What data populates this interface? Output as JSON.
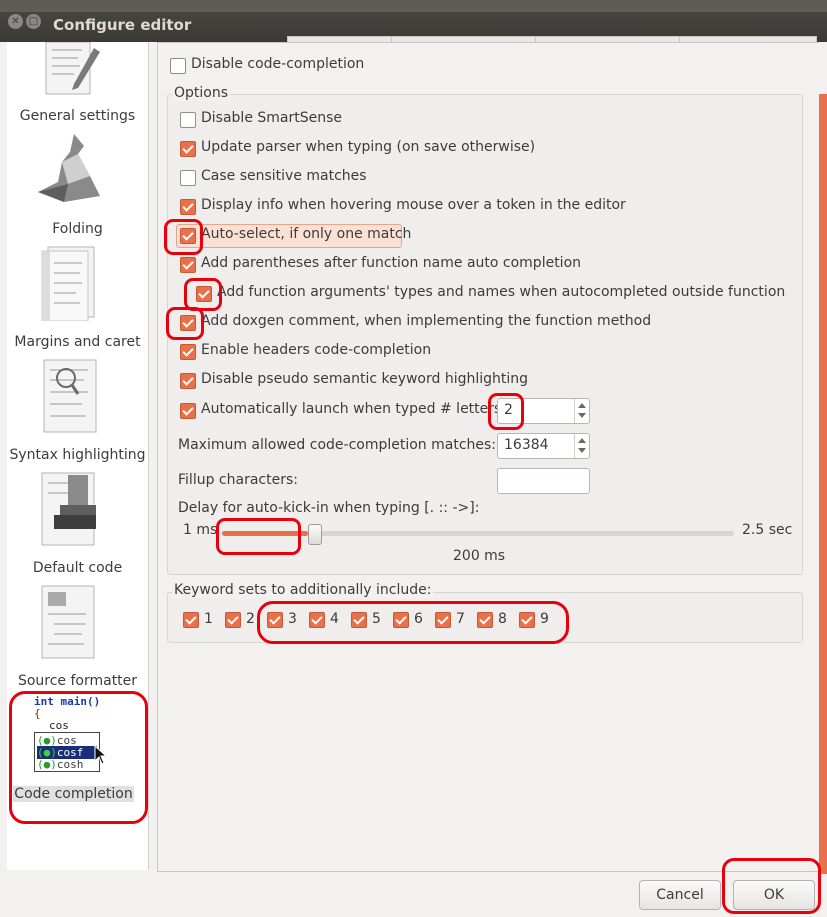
{
  "window": {
    "title": "Configure editor"
  },
  "sidebar": {
    "items": [
      {
        "label": "General settings",
        "icon": "pencil-paper-icon"
      },
      {
        "label": "Folding",
        "icon": "origami-icon"
      },
      {
        "label": "Margins and caret",
        "icon": "margins-paper-icon"
      },
      {
        "label": "Syntax highlighting",
        "icon": "magnifier-paper-icon"
      },
      {
        "label": "Default code",
        "icon": "stamp-paper-icon"
      },
      {
        "label": "Source formatter",
        "icon": "formatter-paper-icon"
      },
      {
        "label": "Code completion",
        "icon": "code-completion-icon"
      }
    ],
    "code_preview": {
      "line1": "int main()",
      "line2": "{",
      "line3": "cos",
      "completions": [
        "cos",
        "cosf",
        "cosh"
      ]
    }
  },
  "main": {
    "disable_code_completion": {
      "label": "Disable code-completion",
      "checked": false
    },
    "options_title": "Options",
    "options": [
      {
        "label": "Disable SmartSense",
        "checked": false
      },
      {
        "label": "Update parser when typing (on save otherwise)",
        "checked": true
      },
      {
        "label": "Case sensitive matches",
        "checked": false
      },
      {
        "label": "Display info when hovering mouse over a token in the editor",
        "checked": true
      },
      {
        "label": "Auto-select, if only one match",
        "checked": true
      },
      {
        "label": "Add parentheses after function name auto completion",
        "checked": true
      },
      {
        "label": "Add function arguments' types and names when autocompleted outside function",
        "checked": true
      },
      {
        "label": "Add doxgen comment, when implementing the function method",
        "checked": true
      },
      {
        "label": "Enable headers code-completion",
        "checked": true
      },
      {
        "label": "Disable pseudo semantic keyword highlighting",
        "checked": true
      },
      {
        "label": "Automatically launch when typed # letters:",
        "checked": true
      }
    ],
    "launch_letters": "2",
    "max_matches_label": "Maximum allowed code-completion matches:",
    "max_matches_value": "16384",
    "fillup_label": "Fillup characters:",
    "fillup_value": "",
    "delay_label": "Delay for auto-kick-in when typing [. :: ->]:",
    "delay_min": "1 ms",
    "delay_max": "2.5 sec",
    "delay_value": "200 ms",
    "delay_fraction": 0.09,
    "keyword_title": "Keyword sets to additionally include:",
    "keyword_sets": [
      "1",
      "2",
      "3",
      "4",
      "5",
      "6",
      "7",
      "8",
      "9"
    ]
  },
  "buttons": {
    "cancel": "Cancel",
    "ok": "OK"
  },
  "colors": {
    "accent": "#e8704a",
    "annotation": "#e8000c"
  }
}
